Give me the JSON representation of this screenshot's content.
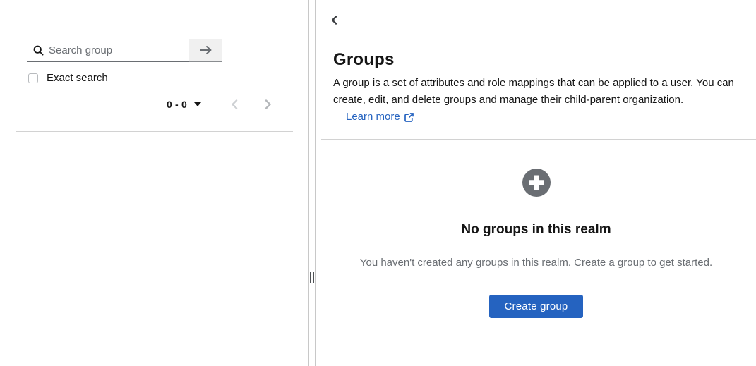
{
  "colors": {
    "primary_blue": "#2563c0",
    "link_blue": "#2563c0",
    "text_primary": "#151515",
    "text_muted": "#6a6e73",
    "icon_gray": "#6a6e73",
    "divider_gray": "#d2d2d2",
    "control_bg": "#f0f0f0"
  },
  "left_panel": {
    "search": {
      "placeholder": "Search group",
      "value": ""
    },
    "exact_search_label": "Exact search",
    "pagination": {
      "range": "0 - 0"
    }
  },
  "main_panel": {
    "title": "Groups",
    "description": "A group is a set of attributes and role mappings that can be applied to a user. You can create, edit, and delete groups and manage their child-parent organization.",
    "learn_more_label": "Learn more",
    "empty_state": {
      "heading": "No groups in this realm",
      "body": "You haven't created any groups in this realm. Create a group to get started.",
      "create_button_label": "Create group"
    }
  },
  "icons": {
    "search": "magnifier",
    "search_submit": "arrow-right",
    "pagination_toggle": "caret-down",
    "pagination_prev": "angle-left",
    "pagination_next": "angle-right",
    "back": "angle-left",
    "learn_more": "external-link",
    "empty_state": "plus-circle",
    "splitter": "drag-handle"
  }
}
